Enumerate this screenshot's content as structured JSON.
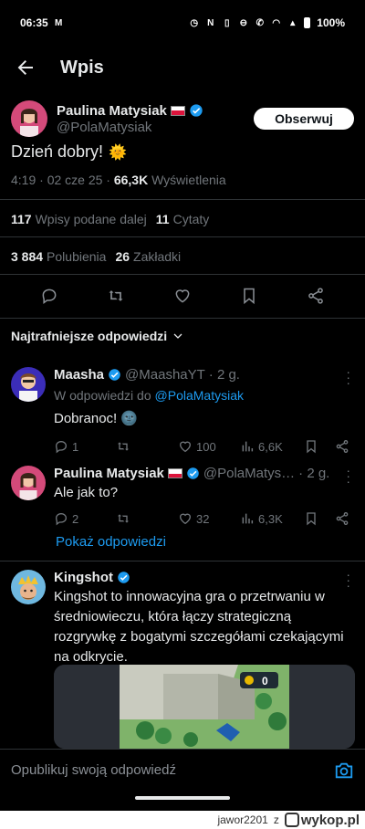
{
  "status_bar": {
    "time": "06:35",
    "mail_icon": "M",
    "battery": "100%"
  },
  "header": {
    "title": "Wpis"
  },
  "post": {
    "author_name": "Paulina Matysiak",
    "author_handle": "@PolaMatysiak",
    "follow_label": "Obserwuj",
    "text": "Dzień dobry!",
    "emoji": "🌞",
    "time": "4:19 · 02 cze 25 · ",
    "views_count": "66,3K",
    "views_label": "Wyświetlenia",
    "reposts_count": "117",
    "reposts_label": "Wpisy podane dalej",
    "quotes_count": "11",
    "quotes_label": "Cytaty",
    "likes_count": "3 884",
    "likes_label": "Polubienia",
    "bookmarks_count": "26",
    "bookmarks_label": "Zakładki"
  },
  "sort": {
    "label": "Najtrafniejsze odpowiedzi"
  },
  "replies": [
    {
      "name": "Maasha",
      "handle": "@MaashaYT",
      "time": "· 2 g.",
      "in_reply_prefix": "W odpowiedzi do ",
      "in_reply_handle": "@PolaMatysiak",
      "text": "Dobranoc!",
      "emoji": "🌚",
      "replies": "1",
      "reposts": "",
      "likes": "100",
      "views": "6,6K"
    },
    {
      "name": "Paulina Matysiak",
      "handle": "@PolaMatys…",
      "time": "· 2 g.",
      "text": "Ale jak to?",
      "replies": "2",
      "reposts": "",
      "likes": "32",
      "views": "6,3K"
    }
  ],
  "show_replies_label": "Pokaż odpowiedzi",
  "promo": {
    "name": "Kingshot",
    "text": "Kingshot to innowacyjna gra o przetrwaniu w średniowieczu, która łączy strategiczną rozgrywkę z bogatymi szczegółami czekającymi na odkrycie.",
    "coin_count": "0"
  },
  "composer": {
    "placeholder": "Opublikuj swoją odpowiedź"
  },
  "footer": {
    "user": "jawor2201",
    "z": "z",
    "site": "wykop.pl"
  },
  "colors": {
    "accent": "#1d9bf0",
    "background": "#000000",
    "muted": "#71767b"
  }
}
